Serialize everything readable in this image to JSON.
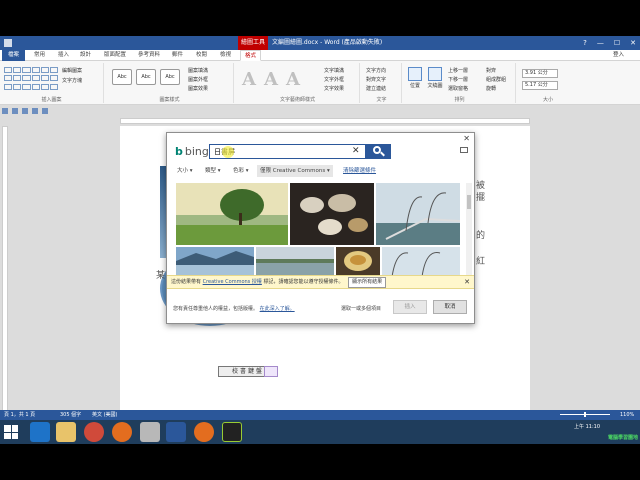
{
  "titlebar": {
    "context_tab": "繪圖工具",
    "title": "文編圖繪圖.docx - Word (產品啟動失敗)",
    "win_buttons": [
      "?",
      "—",
      "☐",
      "✕"
    ]
  },
  "tabs": [
    "檔案",
    "常用",
    "插入",
    "設計",
    "版面配置",
    "參考資料",
    "郵件",
    "校閱",
    "檢視",
    "格式"
  ],
  "user": "登入",
  "ribbon": {
    "groups": [
      "插入圖案",
      "圖案樣式",
      "文字藝術師樣式",
      "文字",
      "排列",
      "大小"
    ],
    "commands": {
      "edit_shape": "編輯圖案",
      "text_box": "文字方塊",
      "shape_fill": "圖案填滿",
      "shape_outline": "圖案外框",
      "shape_effects": "圖案效果",
      "text_fill": "文字填滿",
      "text_outline": "文字外框",
      "text_effects": "文字效果",
      "text_direction": "文字方向",
      "align_text": "對齊文字",
      "create_link": "建立連結",
      "position": "位置",
      "wrap_text": "文繞圖",
      "bring_forward": "上移一層",
      "send_backward": "下移一層",
      "selection_pane": "選取窗格",
      "align": "對齊",
      "group": "組成群組",
      "rotate": "旋轉"
    },
    "style_boxes": [
      "Abc",
      "Abc",
      "Abc"
    ],
    "wordart": [
      "A",
      "A",
      "A"
    ],
    "height": "3.91 公分",
    "width": "5.17 公分"
  },
  "document": {
    "frag_right": [
      "被",
      "擺",
      "的",
      "紅"
    ],
    "frag_left": "某",
    "tag_label": "校書鍵盤"
  },
  "dialog": {
    "bing": "bing",
    "search_value": "日書屏",
    "filters": {
      "size": "大小 ▾",
      "type": "類型 ▾",
      "color": "色彩 ▾",
      "license": "僅限 Creative Commons ▾",
      "clear": "清除篩選條件"
    },
    "notice": {
      "text1": "這份結果帶有",
      "link": "Creative Commons 授權",
      "text2": "標記，請確認您能以遵守授權條件。",
      "button": "顯示所有結果"
    },
    "footer": {
      "text": "您有責任尊重他人的權益，包括版權。",
      "link": "在此深入了解。",
      "selected": "選取一或多個項目"
    },
    "insert_label": "插入",
    "cancel_label": "取消"
  },
  "status": {
    "page": "頁 1，共 1 頁",
    "words": "305 個字",
    "lang": "英文 (美國)",
    "zoom": "110%"
  },
  "taskbar": {
    "time": "上午 11:10",
    "watermark": "電腦學習園地"
  },
  "colors": {
    "word_blue": "#2b579a",
    "context_red": "#c00000",
    "taskbar": "#1f3d5c"
  }
}
